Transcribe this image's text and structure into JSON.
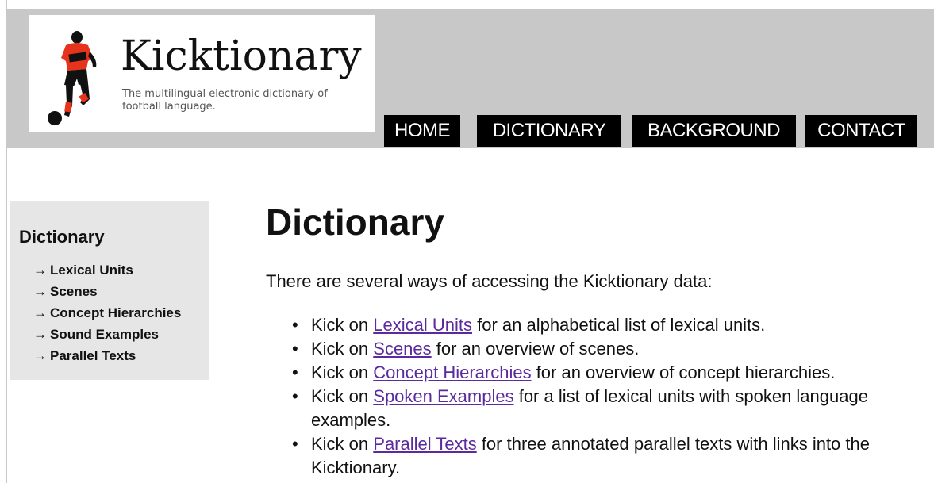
{
  "site": {
    "title": "Kicktionary",
    "tagline": "The multilingual electronic dictionary of football language."
  },
  "nav": {
    "home": "HOME",
    "dictionary": "DICTIONARY",
    "background": "BACKGROUND",
    "contact": "CONTACT"
  },
  "sidebar": {
    "title": "Dictionary",
    "arrow": "→",
    "items": [
      {
        "label": "Lexical Units"
      },
      {
        "label": "Scenes"
      },
      {
        "label": "Concept Hierarchies"
      },
      {
        "label": "Sound Examples"
      },
      {
        "label": "Parallel Texts"
      }
    ]
  },
  "main": {
    "heading": "Dictionary",
    "intro": "There are several ways of accessing the Kicktionary data:",
    "bullets": [
      {
        "prefix": "Kick on ",
        "link": "Lexical Units",
        "suffix": " for an alphabetical list of lexical units."
      },
      {
        "prefix": "Kick on ",
        "link": "Scenes",
        "suffix": " for an overview of scenes."
      },
      {
        "prefix": "Kick on ",
        "link": "Concept Hierarchies",
        "suffix": " for an overview of concept hierarchies."
      },
      {
        "prefix": "Kick on ",
        "link": "Spoken Examples",
        "suffix": " for a list of lexical units with spoken language examples."
      },
      {
        "prefix": "Kick on ",
        "link": "Parallel Texts",
        "suffix": " for three annotated parallel texts with links into the Kicktionary."
      }
    ]
  },
  "colors": {
    "header_bg": "#c8c8c8",
    "nav_bg": "#000000",
    "sidebar_bg": "#e6e6e6",
    "link": "#5a2a9e",
    "player_shirt": "#e8331c"
  }
}
